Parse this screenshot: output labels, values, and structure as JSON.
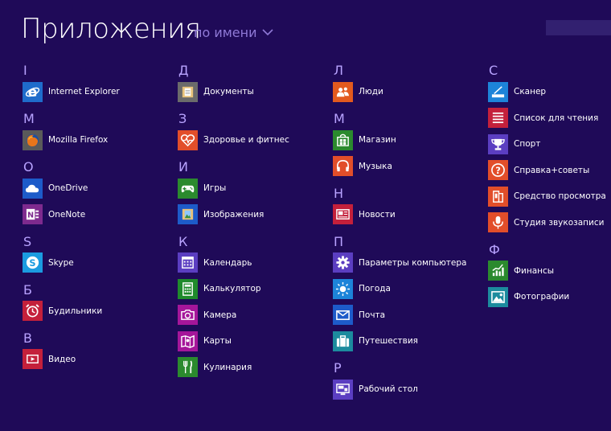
{
  "header": {
    "title": "Приложения",
    "sort_label": "по имени"
  },
  "columns": [
    {
      "groups": [
        {
          "letter": "I",
          "apps": [
            {
              "label": "Internet Explorer",
              "icon": "internet-explorer-icon",
              "color": "#1f6ccb"
            }
          ]
        },
        {
          "letter": "M",
          "apps": [
            {
              "label": "Mozilla Firefox",
              "icon": "firefox-icon",
              "color": "#5a5a5a"
            }
          ]
        },
        {
          "letter": "O",
          "apps": [
            {
              "label": "OneDrive",
              "icon": "cloud-icon",
              "color": "#1d5bc9"
            },
            {
              "label": "OneNote",
              "icon": "onenote-icon",
              "color": "#7e2a8e"
            }
          ]
        },
        {
          "letter": "S",
          "apps": [
            {
              "label": "Skype",
              "icon": "skype-icon",
              "color": "#1b9be0"
            }
          ]
        },
        {
          "letter": "Б",
          "apps": [
            {
              "label": "Будильники",
              "icon": "alarm-clock-icon",
              "color": "#c4203b"
            }
          ]
        },
        {
          "letter": "В",
          "apps": [
            {
              "label": "Видео",
              "icon": "video-icon",
              "color": "#c4203b"
            }
          ]
        }
      ]
    },
    {
      "groups": [
        {
          "letter": "Д",
          "apps": [
            {
              "label": "Документы",
              "icon": "documents-folder-icon",
              "color": "#6b6b6b"
            }
          ]
        },
        {
          "letter": "З",
          "apps": [
            {
              "label": "Здоровье и фитнес",
              "icon": "heart-pulse-icon",
              "color": "#e24e2a"
            }
          ]
        },
        {
          "letter": "И",
          "apps": [
            {
              "label": "Игры",
              "icon": "gamepad-icon",
              "color": "#2b8a2e"
            },
            {
              "label": "Изображения",
              "icon": "pictures-folder-icon",
              "color": "#1d5bc9"
            }
          ]
        },
        {
          "letter": "К",
          "apps": [
            {
              "label": "Календарь",
              "icon": "calendar-icon",
              "color": "#5b3ec1"
            },
            {
              "label": "Калькулятор",
              "icon": "calculator-icon",
              "color": "#1f8a2c"
            },
            {
              "label": "Камера",
              "icon": "camera-icon",
              "color": "#a5169a"
            },
            {
              "label": "Карты",
              "icon": "map-icon",
              "color": "#a5169a"
            },
            {
              "label": "Кулинария",
              "icon": "cutlery-icon",
              "color": "#2b8a2e"
            }
          ]
        }
      ]
    },
    {
      "groups": [
        {
          "letter": "Л",
          "apps": [
            {
              "label": "Люди",
              "icon": "people-icon",
              "color": "#e35a1e"
            }
          ]
        },
        {
          "letter": "М",
          "apps": [
            {
              "label": "Магазин",
              "icon": "store-icon",
              "color": "#2b8a2e"
            },
            {
              "label": "Музыка",
              "icon": "headphones-icon",
              "color": "#e24e2a"
            }
          ]
        },
        {
          "letter": "Н",
          "apps": [
            {
              "label": "Новости",
              "icon": "news-icon",
              "color": "#c4203b"
            }
          ]
        },
        {
          "letter": "П",
          "apps": [
            {
              "label": "Параметры компьютера",
              "icon": "gear-icon",
              "color": "#5b3ec1"
            },
            {
              "label": "Погода",
              "icon": "sun-icon",
              "color": "#1d84d9"
            },
            {
              "label": "Почта",
              "icon": "mail-icon",
              "color": "#1d5bc9"
            },
            {
              "label": "Путешествия",
              "icon": "suitcase-icon",
              "color": "#1c8b9e"
            }
          ]
        },
        {
          "letter": "Р",
          "apps": [
            {
              "label": "Рабочий стол",
              "icon": "desktop-icon",
              "color": "#5b3ec1"
            }
          ]
        }
      ]
    },
    {
      "groups": [
        {
          "letter": "С",
          "apps": [
            {
              "label": "Сканер",
              "icon": "scanner-icon",
              "color": "#1d84d9"
            },
            {
              "label": "Список для чтения",
              "icon": "reading-list-icon",
              "color": "#c4203b"
            },
            {
              "label": "Спорт",
              "icon": "trophy-icon",
              "color": "#5b3ec1"
            },
            {
              "label": "Справка+советы",
              "icon": "help-icon",
              "color": "#e24e2a"
            },
            {
              "label": "Средство просмотра",
              "icon": "reader-icon",
              "color": "#e24e2a"
            },
            {
              "label": "Студия звукозаписи",
              "icon": "microphone-icon",
              "color": "#e24e2a"
            }
          ]
        },
        {
          "letter": "Ф",
          "apps": [
            {
              "label": "Финансы",
              "icon": "finance-chart-icon",
              "color": "#2b8a2e"
            },
            {
              "label": "Фотографии",
              "icon": "photos-icon",
              "color": "#1c8b9e"
            }
          ]
        }
      ]
    }
  ]
}
